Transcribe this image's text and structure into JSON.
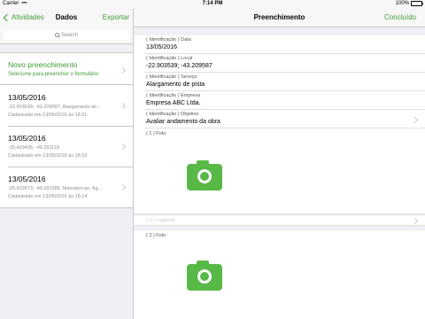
{
  "status_bar": {
    "carrier": "Carrier",
    "time": "7:14 PM",
    "battery": "100%"
  },
  "left_nav": {
    "back_label": "Atividades",
    "title": "Dados",
    "export_label": "Exportar"
  },
  "search": {
    "placeholder": "Search"
  },
  "new_entry": {
    "title": "Novo preenchimento",
    "subtitle": "Selecione para preencher o formulário"
  },
  "records": [
    {
      "date": "13/05/2016",
      "location": "-22.903539; -43.209587, Alargamento de...",
      "registered": "Cadastrado em 13/05/2016 às 18:31"
    },
    {
      "date": "13/05/2016",
      "location": "-25.429495; -49.291118",
      "registered": "Cadastrado em 13/05/2016 às 18:19"
    },
    {
      "date": "13/05/2016",
      "location": "-25.429573; -49.291085, Manutencao, Ag...",
      "registered": "Cadastrado em 13/05/2016 às 18:14"
    }
  ],
  "right_nav": {
    "title": "Preenchimento",
    "done_label": "Concluído"
  },
  "fields": [
    {
      "label": "( Identificação ) Data",
      "value": "13/05/2016"
    },
    {
      "label": "( Identificação ) Local",
      "value": "-22.903539; -43.209587"
    },
    {
      "label": "( Identificação ) Serviço",
      "value": "Alargamento de pista"
    },
    {
      "label": "( Identificação ) Empresa",
      "value": "Empresa ABC Ltda."
    },
    {
      "label": "( Identificação ) Objetivo",
      "value": "Avaliar andamento da obra"
    }
  ],
  "photos": [
    {
      "label": "( 1 ) Foto",
      "caption_placeholder": "( 1 ) Legenda"
    },
    {
      "label": "( 2 ) Foto"
    }
  ],
  "icons": {
    "back": "chevron-left-icon",
    "search": "magnifier-icon",
    "disclosure": "chevron-right-icon",
    "camera": "camera-icon"
  },
  "colors": {
    "accent": "#3f9c35",
    "camera": "#58b947",
    "background": "#efeff4"
  }
}
